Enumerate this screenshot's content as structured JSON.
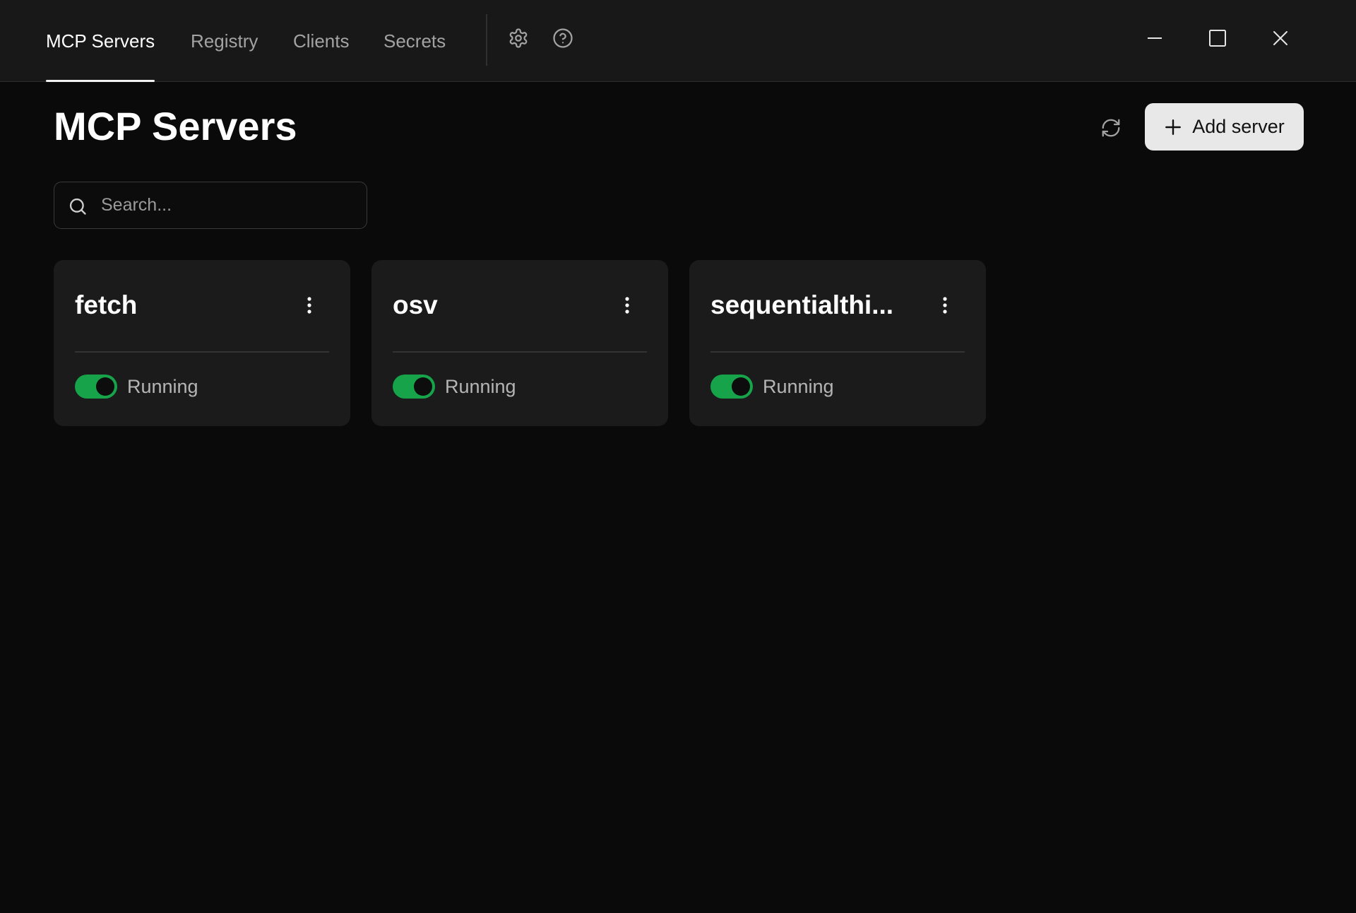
{
  "titlebar": {
    "tabs": [
      {
        "label": "MCP Servers",
        "active": true
      },
      {
        "label": "Registry",
        "active": false
      },
      {
        "label": "Clients",
        "active": false
      },
      {
        "label": "Secrets",
        "active": false
      }
    ],
    "icons": [
      "gear-icon",
      "help-circle-icon"
    ],
    "window_controls": [
      "minimize-icon",
      "maximize-icon",
      "close-icon"
    ]
  },
  "header": {
    "title": "MCP Servers",
    "refresh_icon": "refresh-icon",
    "add_button_label": "Add server"
  },
  "search": {
    "placeholder": "Search...",
    "value": ""
  },
  "servers": [
    {
      "name": "fetch",
      "status": "Running",
      "enabled": true
    },
    {
      "name": "osv",
      "status": "Running",
      "enabled": true
    },
    {
      "name": "sequentialthi...",
      "status": "Running",
      "enabled": true
    }
  ],
  "colors": {
    "background": "#0a0a0a",
    "titlebar": "#181818",
    "card": "#1b1b1b",
    "toggle_on": "#16a34a",
    "button_bg": "#e8e8e8"
  }
}
